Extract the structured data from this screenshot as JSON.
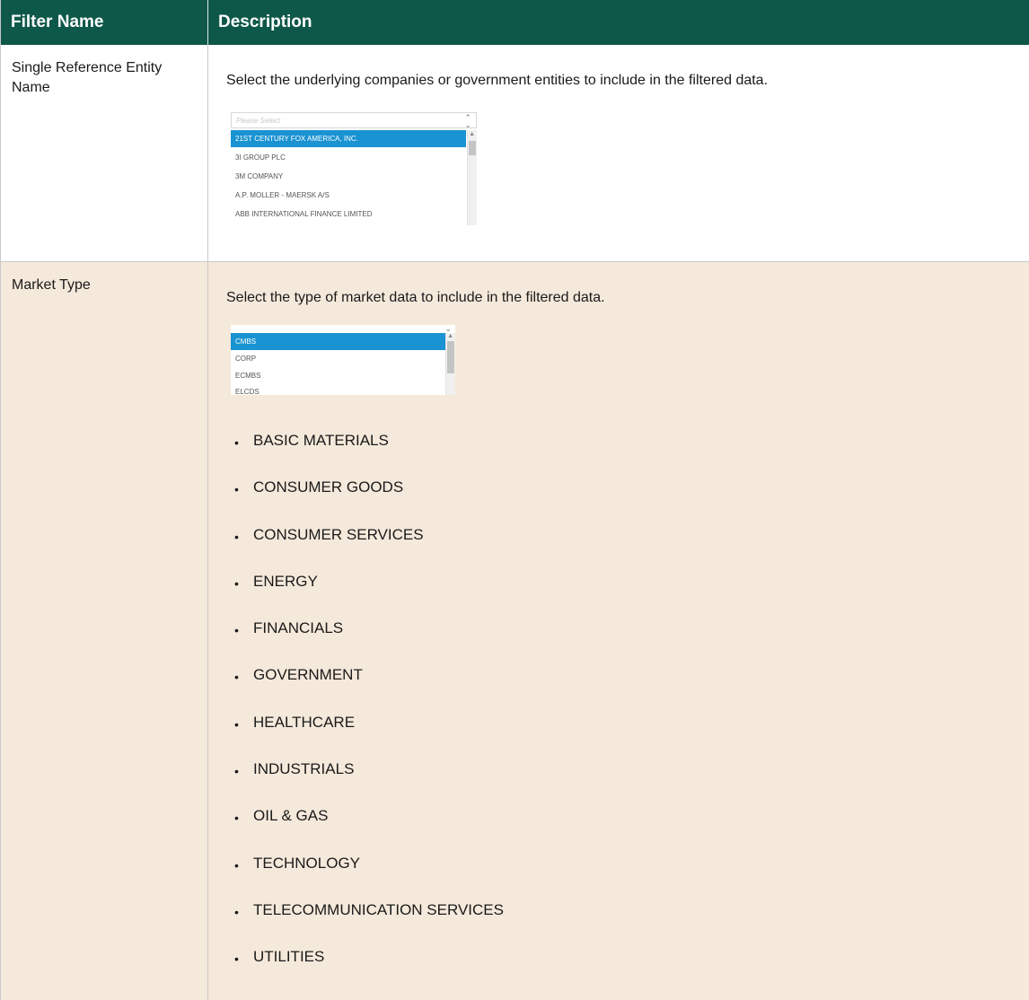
{
  "header": {
    "col1": "Filter Name",
    "col2": "Description"
  },
  "rows": [
    {
      "name": "Single Reference Entity Name",
      "description": "Select the underlying companies or government entities to include in the filtered data.",
      "listbox": {
        "placeholder": "Please Select",
        "options": [
          "21ST CENTURY FOX AMERICA, INC.",
          "3I GROUP PLC",
          "3M COMPANY",
          "A.P. MOLLER - MAERSK A/S",
          "ABB INTERNATIONAL FINANCE LIMITED"
        ],
        "selected": "21ST CENTURY FOX AMERICA, INC."
      }
    },
    {
      "name": "Market Type",
      "description": "Select the type of market data to include in the filtered data.",
      "listbox": {
        "options": [
          "CMBS",
          "CORP",
          "ECMBS",
          "ELCDS"
        ],
        "selected": "CMBS"
      },
      "bullets": [
        "BASIC MATERIALS",
        "CONSUMER GOODS",
        "CONSUMER SERVICES",
        "ENERGY",
        "FINANCIALS",
        "GOVERNMENT",
        "HEALTHCARE",
        "INDUSTRIALS",
        "OIL & GAS",
        "TECHNOLOGY",
        "TELECOMMUNICATION SERVICES",
        "UTILITIES"
      ]
    }
  ],
  "colors": {
    "header_bg": "#0e584a",
    "row2_bg": "#f5e9db",
    "selected_option": "#1a93d2"
  }
}
